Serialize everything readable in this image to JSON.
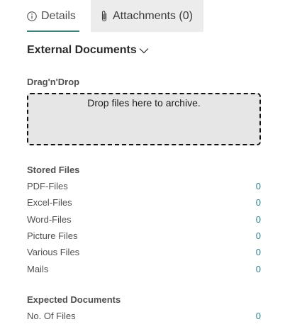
{
  "tabs": {
    "details_label": "Details",
    "attachments_label": "Attachments (0)"
  },
  "section": {
    "title": "External Documents"
  },
  "dragdrop": {
    "label": "Drag'n'Drop",
    "hint": "Drop files here to archive."
  },
  "stored_files": {
    "title": "Stored Files",
    "rows": [
      {
        "label": "PDF-Files",
        "value": "0"
      },
      {
        "label": "Excel-Files",
        "value": "0"
      },
      {
        "label": "Word-Files",
        "value": "0"
      },
      {
        "label": "Picture Files",
        "value": "0"
      },
      {
        "label": "Various Files",
        "value": "0"
      },
      {
        "label": "Mails",
        "value": "0"
      }
    ]
  },
  "expected_documents": {
    "title": "Expected Documents",
    "rows": [
      {
        "label": "No. Of Files",
        "value": "0"
      }
    ]
  },
  "colors": {
    "accent": "#3d8079",
    "link": "#2f7f8a",
    "dropzone_bg": "#e6e6e6",
    "tab_bg": "#ececec"
  },
  "icons": {
    "details": "info-icon",
    "attachments": "paperclip-icon",
    "section_toggle": "chevron-down-icon"
  }
}
